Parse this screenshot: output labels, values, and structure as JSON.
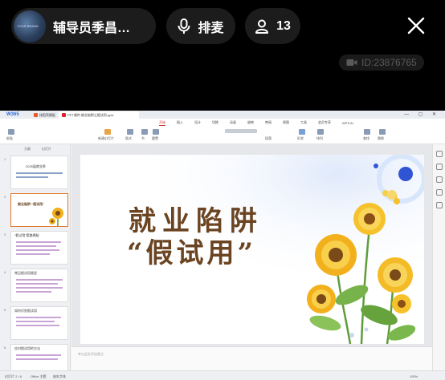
{
  "stream": {
    "host_name": "辅导员季昌…",
    "host_avatar_text": "YOUR BRAND",
    "mic_label": "排麦",
    "viewer_count": "13",
    "room_id": "ID:23876765"
  },
  "wps": {
    "logo": "W365",
    "tabs": [
      {
        "label": "找稻壳模板"
      },
      {
        "label": "PPT课件:就业陷阱之假试用.pptx"
      }
    ],
    "window_controls": "— ▢ ✕",
    "menu": [
      "开始",
      "插入",
      "设计",
      "切换",
      "动画",
      "放映",
      "审阅",
      "视图",
      "工具",
      "会员专享",
      "WPS AI"
    ],
    "ribbon_labels": [
      "粘贴",
      "新建幻灯片",
      "版式",
      "节",
      "重置",
      "段落",
      "形状",
      "排列",
      "查找",
      "替换"
    ],
    "sidebar_tabs": [
      "大纲",
      "幻灯片"
    ],
    "thumbnails": [
      {
        "num": "1",
        "title": "2025届就业季"
      },
      {
        "num": "2",
        "title": "就业陷阱 “假试用”"
      },
      {
        "num": "3",
        "title": "“假试用”套路揭秘"
      },
      {
        "num": "4",
        "title": "常见假试用类型"
      },
      {
        "num": "5",
        "title": "如何识别假试用"
      },
      {
        "num": "6",
        "title": "应对假试用的方法"
      }
    ],
    "notes_placeholder": "单击此处添加备注",
    "status_slide": "幻灯片 2 / 8",
    "status_theme": "Office 主题",
    "status_font": "缺失字体",
    "status_zoom": "100%"
  },
  "slide": {
    "line1": "就业陷阱",
    "line2": "“假试用”"
  },
  "colors": {
    "title_brown": "#6b4422",
    "accent_blue": "#2d6bd8",
    "sunflower": "#f2b11c"
  }
}
